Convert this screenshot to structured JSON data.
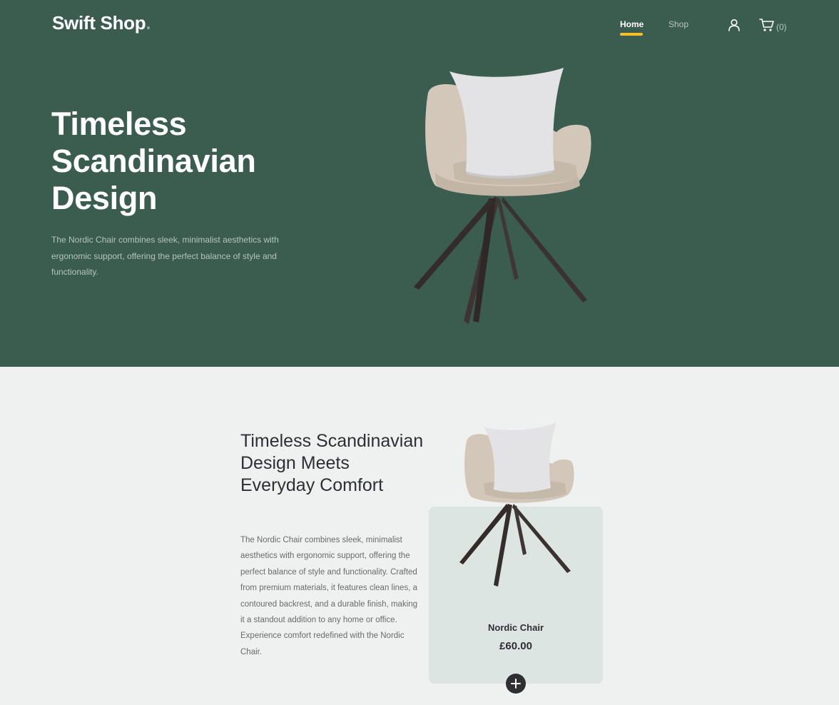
{
  "header": {
    "logo_text": "Swift Shop",
    "logo_dot": ".",
    "nav": [
      {
        "label": "Home",
        "active": true
      },
      {
        "label": "Shop",
        "active": false
      }
    ],
    "cart_count": "(0)",
    "icons": [
      "user-icon",
      "cart-icon"
    ]
  },
  "hero": {
    "title": "Timeless Scandinavian Design",
    "description": "The Nordic Chair combines sleek, minimalist aesthetics with ergonomic support, offering the perfect balance of style and functionality."
  },
  "feature": {
    "title": "Timeless Scandinavian Design Meets Everyday Comfort",
    "description": "The Nordic Chair combines sleek, minimalist aesthetics with ergonomic support, offering the perfect balance of style and functionality. Crafted from premium materials, it features clean lines, a contoured backrest, and a durable finish, making it a standout addition to any home or office. Experience comfort redefined with the Nordic Chair."
  },
  "product": {
    "name": "Nordic Chair",
    "price": "£60.00",
    "add_icon": "plus-icon"
  },
  "colors": {
    "hero_bg": "#3b5d50",
    "page_bg": "#eff1f0",
    "accent": "#f9bf29",
    "card_bg": "#dde5e3",
    "dark": "#2f2f33"
  }
}
